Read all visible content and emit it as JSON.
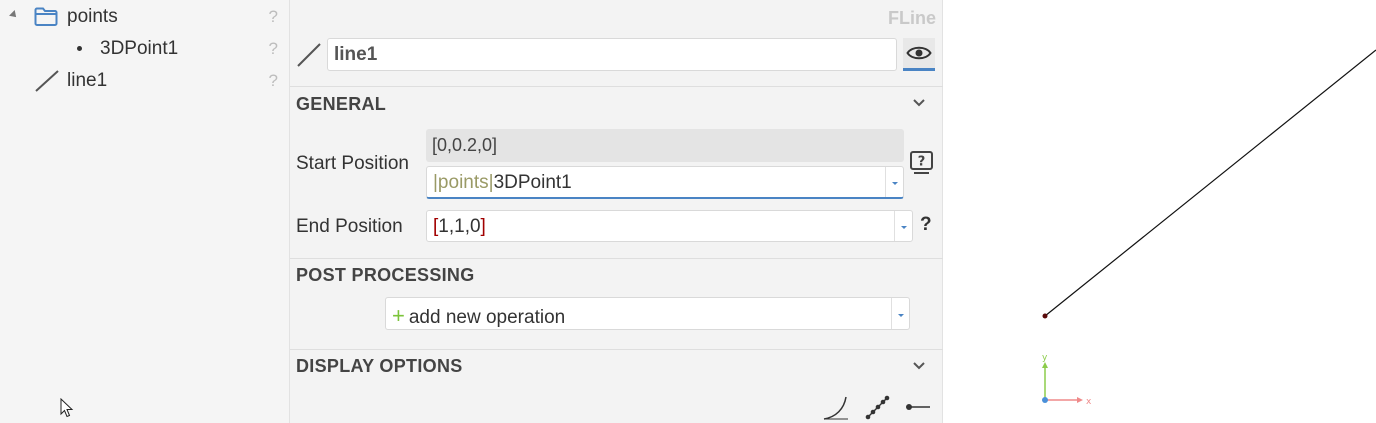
{
  "tree": {
    "items": [
      {
        "label": "points",
        "help": "?",
        "icon": "folder-icon"
      },
      {
        "label": "3DPoint1",
        "help": "?",
        "icon": "bullet-icon"
      },
      {
        "label": "line1",
        "help": "?",
        "icon": "line-icon"
      }
    ]
  },
  "properties": {
    "type_label": "FLine",
    "name_value": "line1",
    "general": {
      "title": "GENERAL",
      "start_label": "Start Position",
      "start_resolved": "[0,0.2,0]",
      "start_ref_path": "|points|",
      "start_ref_name": "3DPoint1",
      "end_label": "End Position",
      "end_open": "[",
      "end_values": "1,1,0",
      "end_close": "]",
      "end_help": "?"
    },
    "post_processing": {
      "title": "POST PROCESSING",
      "add_op_plus": "+",
      "add_op_label": "add new operation"
    },
    "display_options": {
      "title": "DISPLAY OPTIONS"
    }
  },
  "viewport": {
    "axes": {
      "x_label": "x",
      "y_label": "y"
    },
    "colors": {
      "line": "#111111",
      "point": "#5a0a0a",
      "x_axis": "#ef8a8a",
      "y_axis": "#8ccc4a",
      "origin": "#4a90d9"
    }
  },
  "colors": {
    "accent": "#4a84c4",
    "folder": "#4a84c4"
  }
}
